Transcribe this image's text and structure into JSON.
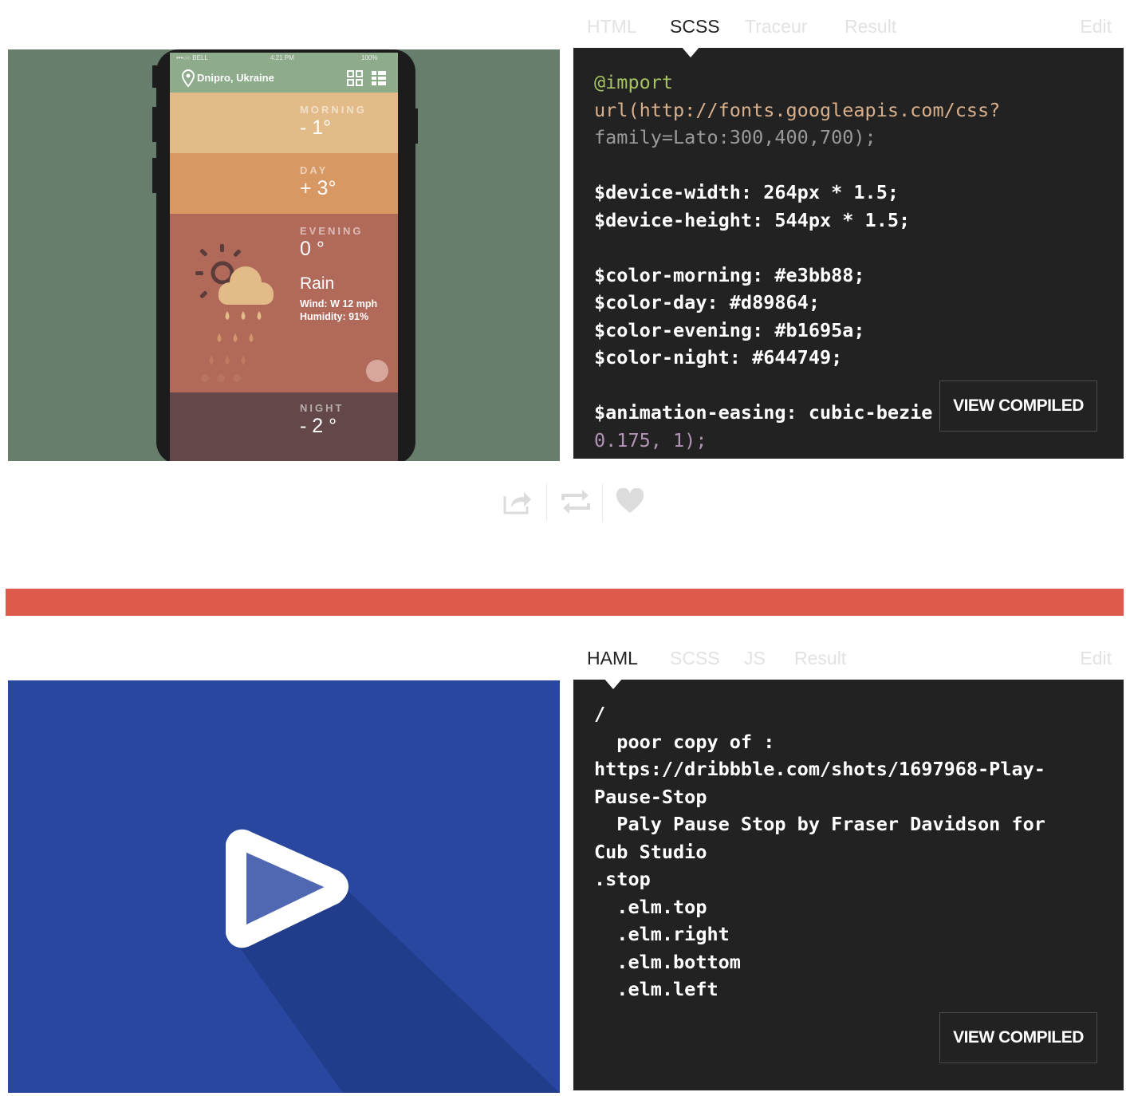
{
  "pen1": {
    "tabs": [
      {
        "label": "HTML",
        "active": false
      },
      {
        "label": "SCSS",
        "active": true
      },
      {
        "label": "Traceur",
        "active": false
      },
      {
        "label": "Result",
        "active": false
      }
    ],
    "edit_label": "Edit",
    "view_compiled": "VIEW COMPILED",
    "code_lines": [
      "@import",
      "url(http://fonts.googleapis.com/css?",
      "family=Lato:300,400,700);",
      "",
      "$device-width: 264px * 1.5;",
      "$device-height: 544px * 1.5;",
      "",
      "$color-morning: #e3bb88;",
      "$color-day: #d89864;",
      "$color-evening: #b1695a;",
      "$color-night: #644749;",
      "",
      "$animation-easing: cubic-bezie",
      "0.175, 1);"
    ],
    "preview": {
      "status_left": "•••○○ BELL",
      "status_time": "4:21 PM",
      "status_right": "100%",
      "location": "Dnipro, Ukraine",
      "bands": [
        {
          "label": "MORNING",
          "temp": "- 1°",
          "color": "#e3bb88"
        },
        {
          "label": "DAY",
          "temp": "+ 3°",
          "color": "#d89864"
        },
        {
          "label": "EVENING",
          "temp": "0 °",
          "color": "#b1695a"
        },
        {
          "label": "NIGHT",
          "temp": "- 2 °",
          "color": "#644749"
        }
      ],
      "condition": "Rain",
      "wind": "Wind: W 12 mph",
      "humidity": "Humidity: 91%"
    }
  },
  "actions": {
    "icons": [
      "share-icon",
      "fork-icon",
      "heart-icon"
    ]
  },
  "accent_color": "#de5a4a",
  "pen2": {
    "tabs": [
      {
        "label": "HAML",
        "active": true
      },
      {
        "label": "SCSS",
        "active": false
      },
      {
        "label": "JS",
        "active": false
      },
      {
        "label": "Result",
        "active": false
      }
    ],
    "edit_label": "Edit",
    "view_compiled": "VIEW COMPILED",
    "code_lines": [
      "/",
      "  poor copy of :",
      "https://dribbble.com/shots/1697968-Play-",
      "Pause-Stop",
      "  Paly Pause Stop by Fraser Davidson for",
      "Cub Studio",
      ".stop",
      "  .elm.top",
      "  .elm.right",
      "  .elm.bottom",
      "  .elm.left"
    ],
    "preview_bg": "#2a47a0"
  }
}
